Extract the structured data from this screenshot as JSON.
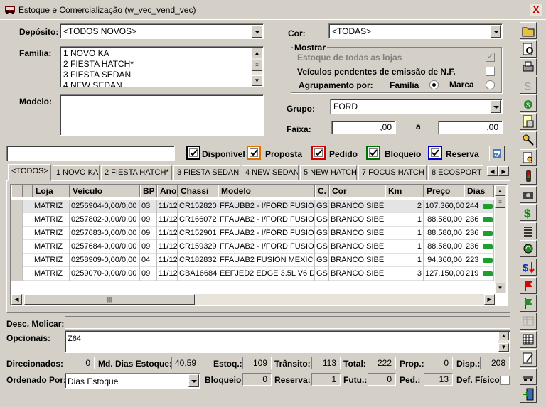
{
  "window": {
    "title": "Estoque e Comercialização (w_vec_vend_vec)",
    "close": "X"
  },
  "filters": {
    "deposito_label": "Depósito:",
    "deposito_value": "<TODOS NOVOS>",
    "familia_label": "Família:",
    "familia_items": [
      "1 NOVO KA",
      "2 FIESTA HATCH*",
      "3 FIESTA SEDAN",
      "4 NEW SEDAN"
    ],
    "modelo_label": "Modelo:",
    "cor_label": "Cor:",
    "cor_value": "<TODAS>",
    "mostrar_label": "Mostrar",
    "estoque_lojas": "Estoque de todas as lojas",
    "pendentes": "Veículos pendentes de emissão de N.F.",
    "agrupamento": "Agrupamento por:",
    "familia_radio": "Família",
    "marca_radio": "Marca",
    "grupo_label": "Grupo:",
    "grupo_value": "FORD",
    "faixa_label": "Faixa:",
    "faixa_from": ",00",
    "faixa_a": "a",
    "faixa_to": ",00"
  },
  "legend": {
    "disponivel": "Disponível",
    "proposta": "Proposta",
    "pedido": "Pedido",
    "bloqueio": "Bloqueio",
    "reserva": "Reserva",
    "colors": {
      "disponivel": "#000000",
      "proposta": "#e07000",
      "pedido": "#d00000",
      "bloqueio": "#007000",
      "reserva": "#0000c0"
    }
  },
  "tabs": [
    "<TODOS>",
    "1 NOVO KA",
    "2 FIESTA HATCH*",
    "3 FIESTA SEDAN",
    "4 NEW SEDAN",
    "5 NEW HATCH",
    "7 FOCUS HATCH",
    "8 ECOSPORT"
  ],
  "grid": {
    "headers": [
      "Loja",
      "Veículo",
      "BP",
      "Ano",
      "Chassi",
      "Modelo",
      "C.",
      "Cor",
      "Km",
      "Preço",
      "Dias"
    ],
    "rows": [
      [
        "MATRIZ",
        "0256904-0,00/0,00",
        "03",
        "11/12",
        "CR152820",
        "FFAUBB2 - I/FORD FUSION \\",
        "GS",
        "BRANCO SIBER",
        "2",
        "107.360,00",
        "244"
      ],
      [
        "MATRIZ",
        "0257802-0,00/0,00",
        "09",
        "11/12",
        "CR166072",
        "FFAUAB2 - I/FORD FUSION",
        "GS",
        "BRANCO SIBER",
        "1",
        "88.580,00",
        "236"
      ],
      [
        "MATRIZ",
        "0257683-0,00/0,00",
        "09",
        "11/12",
        "CR152901",
        "FFAUAB2 - I/FORD FUSION",
        "GS",
        "BRANCO SIBER",
        "1",
        "88.580,00",
        "236"
      ],
      [
        "MATRIZ",
        "0257684-0,00/0,00",
        "09",
        "11/12",
        "CR159329",
        "FFAUAB2 - I/FORD FUSION",
        "GS",
        "BRANCO SIBER",
        "1",
        "88.580,00",
        "236"
      ],
      [
        "MATRIZ",
        "0258909-0,00/0,00",
        "04",
        "11/12",
        "CR182832",
        "FFAUAB2 FUSION MEXICO II",
        "GS",
        "BRANCO SIBER",
        "1",
        "94.360,00",
        "223"
      ],
      [
        "MATRIZ",
        "0259070-0,00/0,00",
        "09",
        "11/12",
        "CBA16684",
        "EEFJED2 EDGE 3.5L V6 DUF",
        "GS",
        "BRANCO SIBER",
        "3",
        "127.150,00",
        "219"
      ]
    ]
  },
  "bottom": {
    "desc_label": "Desc. Molicar:",
    "opcionais_label": "Opcionais:",
    "opcionais_value": "Z64",
    "direcionados_label": "Direcionados:",
    "direcionados": "0",
    "md_label": "Md. Dias Estoque:",
    "md": "40,59",
    "estoq_label": "Estoq.:",
    "estoq": "109",
    "transito_label": "Trânsito:",
    "transito": "113",
    "total_label": "Total:",
    "total": "222",
    "prop_label": "Prop.:",
    "prop": "0",
    "disp_label": "Disp.:",
    "disp": "208",
    "ordenado_label": "Ordenado Por:",
    "ordenado": "Dias Estoque",
    "bloqueio_label": "Bloqueio:",
    "bloqueio": "0",
    "reserva_label": "Reserva:",
    "reserva": "1",
    "futu_label": "Futu.:",
    "futu": "0",
    "ped_label": "Ped.:",
    "ped": "13",
    "def_label": "Def. Físico:"
  },
  "toolbar": [
    "open-folder-icon",
    "search-document-icon",
    "print-preview-icon",
    "dollar-disabled-icon",
    "money-bag-icon",
    "calculator-document-icon",
    "key-icon",
    "document-key-icon",
    "traffic-light-icon",
    "camera-icon",
    "dollar-icon",
    "list-icon",
    "refresh-icon",
    "dollar-arrow-icon",
    "red-flag-icon",
    "green-flag-icon",
    "table-disabled-icon",
    "grid-icon",
    "edit-icon",
    "car-icon",
    "exit-door-icon"
  ]
}
